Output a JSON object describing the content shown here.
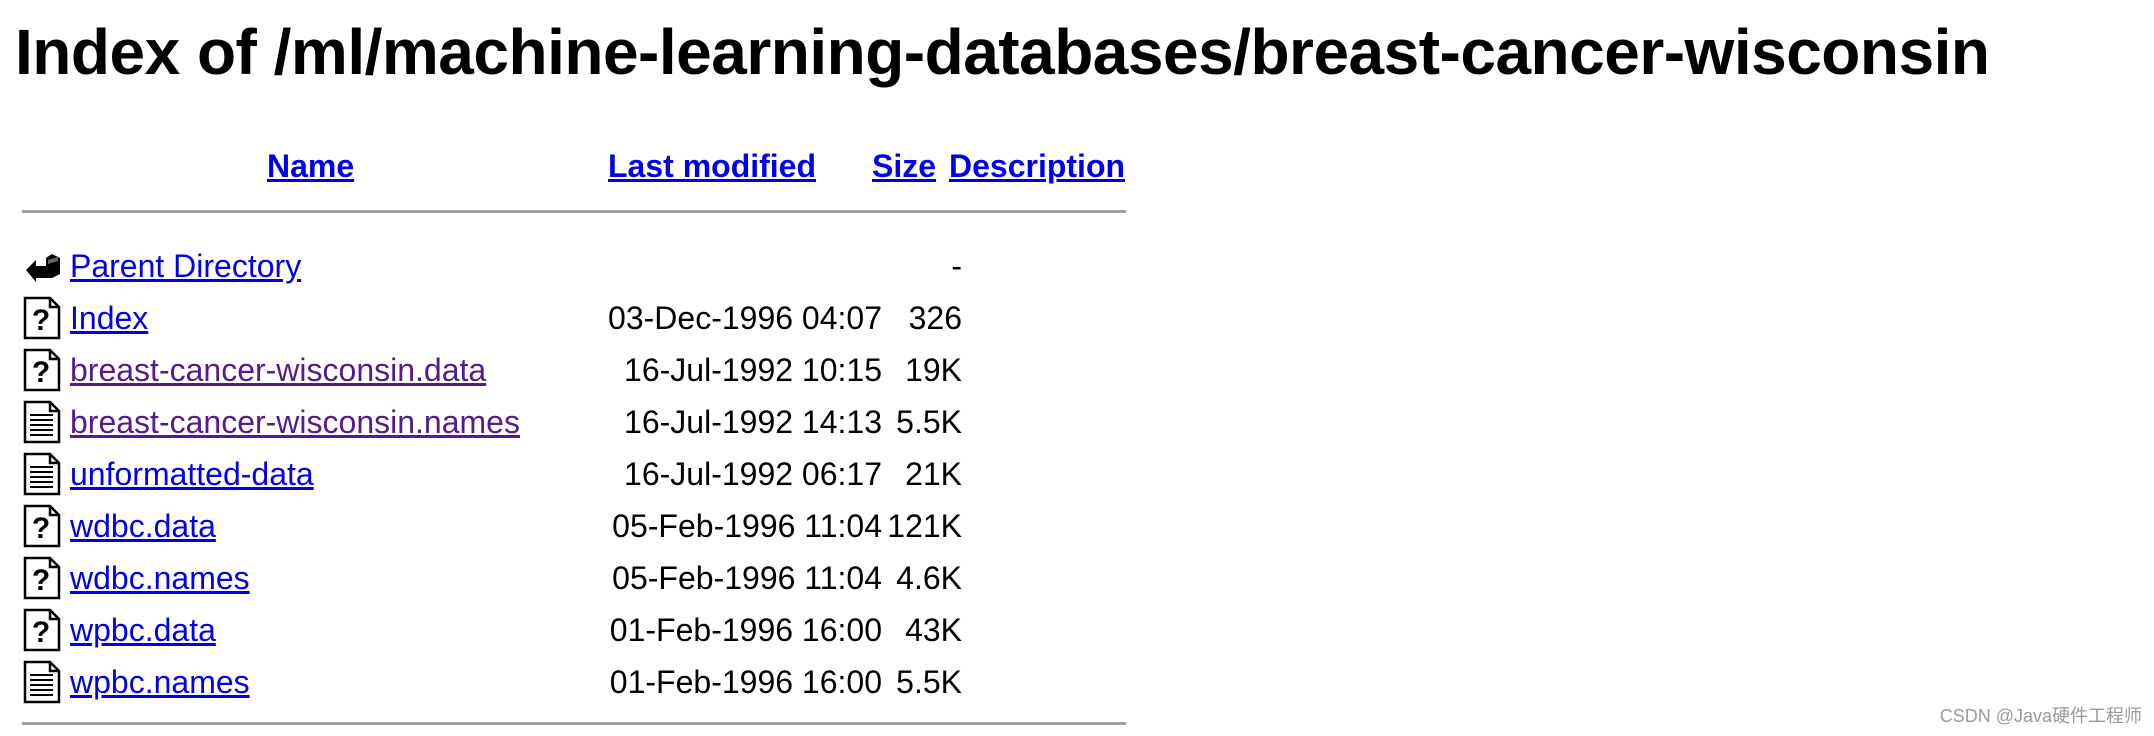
{
  "page": {
    "title": "Index of /ml/machine-learning-databases/breast-cancer-wisconsin"
  },
  "table": {
    "headers": {
      "name": "Name",
      "last_modified": "Last modified",
      "size": "Size",
      "description": "Description"
    },
    "rows": [
      {
        "icon": "back-arrow-icon",
        "name": "Parent Directory",
        "last_modified": "",
        "size": "-",
        "visited": false
      },
      {
        "icon": "unknown-file-icon",
        "name": "Index",
        "last_modified": "03-Dec-1996 04:07",
        "size": "326",
        "visited": false
      },
      {
        "icon": "unknown-file-icon",
        "name": "breast-cancer-wisconsin.data",
        "last_modified": "16-Jul-1992 10:15",
        "size": "19K",
        "visited": true
      },
      {
        "icon": "text-file-icon",
        "name": "breast-cancer-wisconsin.names",
        "last_modified": "16-Jul-1992 14:13",
        "size": "5.5K",
        "visited": true
      },
      {
        "icon": "text-file-icon",
        "name": "unformatted-data",
        "last_modified": "16-Jul-1992 06:17",
        "size": "21K",
        "visited": false
      },
      {
        "icon": "unknown-file-icon",
        "name": "wdbc.data",
        "last_modified": "05-Feb-1996 11:04",
        "size": "121K",
        "visited": false
      },
      {
        "icon": "unknown-file-icon",
        "name": "wdbc.names",
        "last_modified": "05-Feb-1996 11:04",
        "size": "4.6K",
        "visited": false
      },
      {
        "icon": "unknown-file-icon",
        "name": "wpbc.data",
        "last_modified": "01-Feb-1996 16:00",
        "size": "43K",
        "visited": false
      },
      {
        "icon": "text-file-icon",
        "name": "wpbc.names",
        "last_modified": "01-Feb-1996 16:00",
        "size": "5.5K",
        "visited": false
      }
    ]
  },
  "watermark": {
    "text": "CSDN @Java硬件工程师"
  },
  "colors": {
    "link": "#0000ee",
    "visited_link": "#551a8b",
    "rule": "#a0a0a0",
    "watermark": "#9a9a9a"
  }
}
